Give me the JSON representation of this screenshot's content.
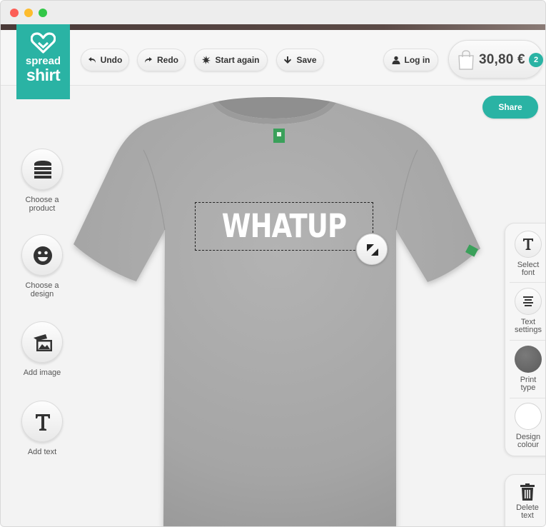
{
  "brand": {
    "line1": "spread",
    "line2": "shirt",
    "color": "#2ab3a4"
  },
  "toolbar": {
    "undo": "Undo",
    "redo": "Redo",
    "start_again": "Start again",
    "save": "Save",
    "login": "Log in"
  },
  "cart": {
    "price": "30,80 €",
    "count": "2"
  },
  "share": "Share",
  "design": {
    "text": "WHATUP",
    "text_color": "#ffffff"
  },
  "product": {
    "color": "#a9a9a9"
  },
  "left_menu": [
    {
      "label_line1": "Choose a",
      "label_line2": "product",
      "icon": "tshirt-stack-icon"
    },
    {
      "label_line1": "Choose a",
      "label_line2": "design",
      "icon": "smiley-icon"
    },
    {
      "label_line1": "Add image",
      "label_line2": "",
      "icon": "image-icon"
    },
    {
      "label_line1": "Add text",
      "label_line2": "",
      "icon": "text-t-icon"
    }
  ],
  "right_menu": [
    {
      "label_line1": "Select",
      "label_line2": "font",
      "icon": "text-t-icon"
    },
    {
      "label_line1": "Text",
      "label_line2": "settings",
      "icon": "align-center-icon"
    },
    {
      "label_line1": "Print",
      "label_line2": "type",
      "swatch": "#666666"
    },
    {
      "label_line1": "Design",
      "label_line2": "colour",
      "swatch": "#ffffff"
    }
  ],
  "delete": {
    "label_line1": "Delete",
    "label_line2": "text"
  }
}
